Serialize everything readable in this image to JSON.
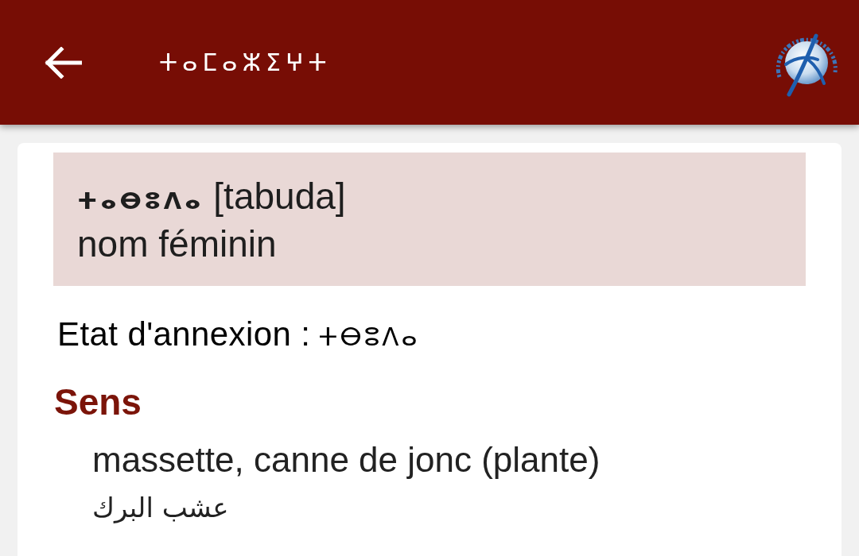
{
  "app_bar": {
    "title": "ⵜⴰⵎⴰⵣⵉⵖⵜ"
  },
  "entry": {
    "headword": "ⵜⴰⴱⵓⴷⴰ",
    "transcription": "[tabuda]",
    "category": "nom féminin"
  },
  "annexation": {
    "label": "Etat d'annexion :",
    "value": "ⵜⴱⵓⴷⴰ"
  },
  "senses": {
    "heading": "Sens",
    "items": [
      {
        "french": "massette, canne de jonc (plante)",
        "arabic": "عشب البرك"
      }
    ]
  }
}
